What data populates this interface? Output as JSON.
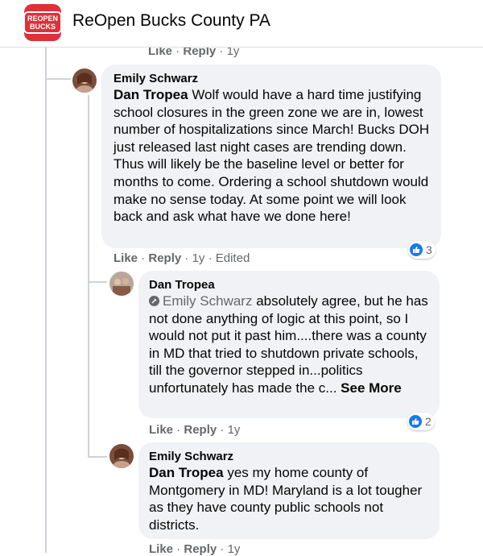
{
  "header": {
    "logo_line1": "REOPEN",
    "logo_line2": "BUCKS",
    "title": "ReOpen Bucks County PA"
  },
  "top_actions": {
    "like": "Like",
    "reply": "Reply",
    "time": "1y"
  },
  "comment1": {
    "author": "Emily Schwarz",
    "mention": "Dan Tropea",
    "text": " Wolf would have a hard time justifying school closures in the green zone we are in, lowest number of hospitalizations since March! Bucks DOH just released last night cases are trending down. Thus will likely be the baseline level or better for months to come. Ordering a school shutdown would make no sense today. At some point we will look back and ask what have we done here!",
    "reaction_count": "3",
    "actions": {
      "like": "Like",
      "reply": "Reply",
      "time": "1y",
      "edited": "Edited"
    }
  },
  "comment2": {
    "author": "Dan Tropea",
    "tag": "Emily Schwarz",
    "text": " absolutely agree, but he has not done anything of logic at this point, so I would not put it past him....there was a county in MD that tried to shutdown private schools, till the governor stepped in...politics unfortunately has made the c...",
    "see_more": "See More",
    "reaction_count": "2",
    "actions": {
      "like": "Like",
      "reply": "Reply",
      "time": "1y"
    }
  },
  "comment3": {
    "author": "Emily Schwarz",
    "mention": "Dan Tropea",
    "text": " yes my home county of Montgomery in MD! Maryland is a lot tougher as they have county public schools not districts.",
    "actions": {
      "like": "Like",
      "reply": "Reply",
      "time": "1y"
    }
  },
  "colors": {
    "logo_red": "#e0303a",
    "like_blue": "#1877f2",
    "bubble_gray": "#f0f2f5"
  }
}
